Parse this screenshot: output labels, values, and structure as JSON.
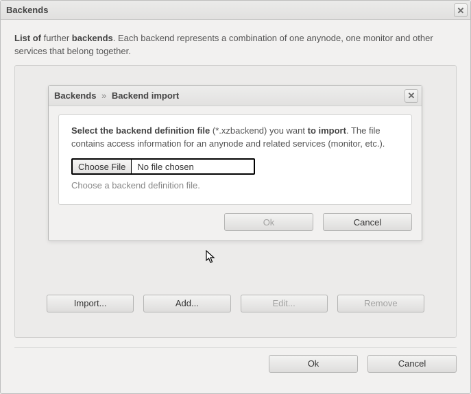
{
  "window": {
    "title": "Backends",
    "close_glyph": "✕"
  },
  "intro": {
    "pre": "List of",
    "bold1": " further ",
    "bold2": "backends",
    "rest": ". Each backend represents a combination of one anynode, one monitor and other services that belong together."
  },
  "list_buttons": {
    "import": "Import...",
    "add": "Add...",
    "edit": "Edit...",
    "remove": "Remove"
  },
  "bottom": {
    "ok": "Ok",
    "cancel": "Cancel"
  },
  "modal": {
    "title_crumb1": "Backends",
    "title_sep": "»",
    "title_crumb2": "Backend import",
    "close_glyph": "✕",
    "instruct": {
      "b1": "Select the backend definition file",
      "t1": " (*.xzbackend) you want ",
      "b2": "to import",
      "t2": ". The file contains access information for an anynode and related services (monitor, etc.)."
    },
    "file": {
      "choose": "Choose File",
      "status": "No file chosen",
      "caption": "Choose a backend definition file."
    },
    "ok": "Ok",
    "cancel": "Cancel"
  }
}
